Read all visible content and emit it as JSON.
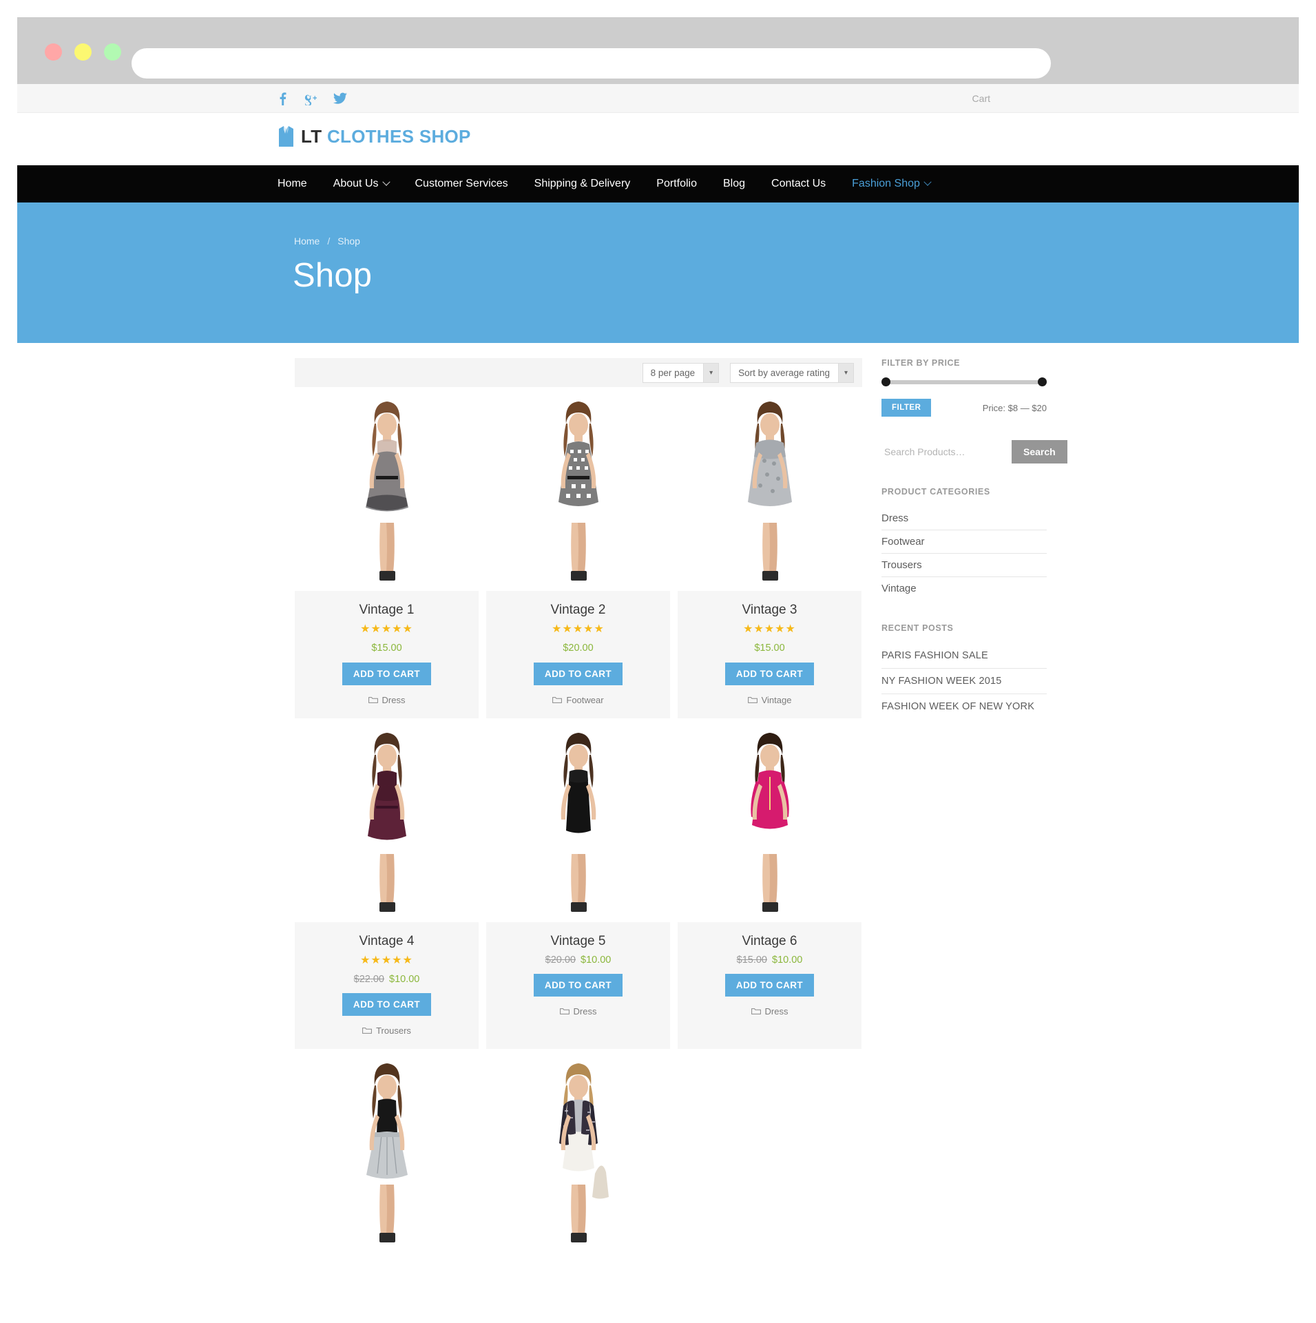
{
  "browser": {
    "url_value": "",
    "url_placeholder": ""
  },
  "topbar": {
    "social": [
      {
        "name": "facebook",
        "label": "f"
      },
      {
        "name": "google-plus",
        "label": "g+"
      },
      {
        "name": "twitter",
        "label": "t"
      }
    ],
    "cart_label": "Cart"
  },
  "logo": {
    "primary": "LT",
    "secondary": "CLOTHES SHOP"
  },
  "nav": {
    "items": [
      {
        "label": "Home",
        "active": false,
        "caret": false
      },
      {
        "label": "About Us",
        "active": false,
        "caret": true
      },
      {
        "label": "Customer Services",
        "active": false,
        "caret": false
      },
      {
        "label": "Shipping & Delivery",
        "active": false,
        "caret": false
      },
      {
        "label": "Portfolio",
        "active": false,
        "caret": false
      },
      {
        "label": "Blog",
        "active": false,
        "caret": false
      },
      {
        "label": "Contact Us",
        "active": false,
        "caret": false
      },
      {
        "label": "Fashion Shop",
        "active": true,
        "caret": true
      }
    ]
  },
  "hero": {
    "breadcrumb": [
      {
        "label": "Home"
      },
      {
        "label": "Shop"
      }
    ],
    "breadcrumb_separator": "/",
    "title": "Shop"
  },
  "toolbar": {
    "per_page": "8 per page",
    "sort_by": "Sort by average rating"
  },
  "products": [
    {
      "name": "Vintage 1",
      "rating": 5,
      "price_old": "",
      "price": "$15.00",
      "button": "ADD TO CART",
      "category": "Dress",
      "image": "dress-lace-floral"
    },
    {
      "name": "Vintage 2",
      "rating": 5,
      "price_old": "",
      "price": "$20.00",
      "button": "ADD TO CART",
      "category": "Footwear",
      "image": "dress-houndstooth"
    },
    {
      "name": "Vintage 3",
      "rating": 5,
      "price_old": "",
      "price": "$15.00",
      "button": "ADD TO CART",
      "category": "Vintage",
      "image": "dress-grey-lace"
    },
    {
      "name": "Vintage 4",
      "rating": 5,
      "price_old": "$22.00",
      "price": "$10.00",
      "button": "ADD TO CART",
      "category": "Trousers",
      "image": "dress-burgundy"
    },
    {
      "name": "Vintage 5",
      "rating": 0,
      "price_old": "$20.00",
      "price": "$10.00",
      "button": "ADD TO CART",
      "category": "Dress",
      "image": "dress-black-bodycon"
    },
    {
      "name": "Vintage 6",
      "rating": 0,
      "price_old": "$15.00",
      "price": "$10.00",
      "button": "ADD TO CART",
      "category": "Dress",
      "image": "dress-pink"
    },
    {
      "name": "",
      "rating": 0,
      "price_old": "",
      "price": "",
      "button": "",
      "category": "",
      "image": "skirt-grey-pleated"
    },
    {
      "name": "",
      "rating": 0,
      "price_old": "",
      "price": "",
      "button": "",
      "category": "",
      "image": "dress-white-tweed-jacket"
    }
  ],
  "sidebar": {
    "filter_price": {
      "title": "FILTER BY PRICE",
      "button": "FILTER",
      "range_label": "Price: $8 — $20",
      "min": 8,
      "max": 20
    },
    "search": {
      "placeholder": "Search Products…",
      "value": "",
      "button": "Search"
    },
    "categories": {
      "title": "PRODUCT CATEGORIES",
      "items": [
        {
          "label": "Dress"
        },
        {
          "label": "Footwear"
        },
        {
          "label": "Trousers"
        },
        {
          "label": "Vintage"
        }
      ]
    },
    "recent_posts": {
      "title": "RECENT POSTS",
      "items": [
        {
          "label": "PARIS FASHION SALE"
        },
        {
          "label": "NY FASHION WEEK 2015"
        },
        {
          "label": "FASHION WEEK OF NEW YORK"
        }
      ]
    }
  },
  "colors": {
    "accent": "#5cacde",
    "nav_bg": "#060606",
    "price": "#8bb73c",
    "star": "#f6b91a",
    "search_button": "#969696"
  }
}
